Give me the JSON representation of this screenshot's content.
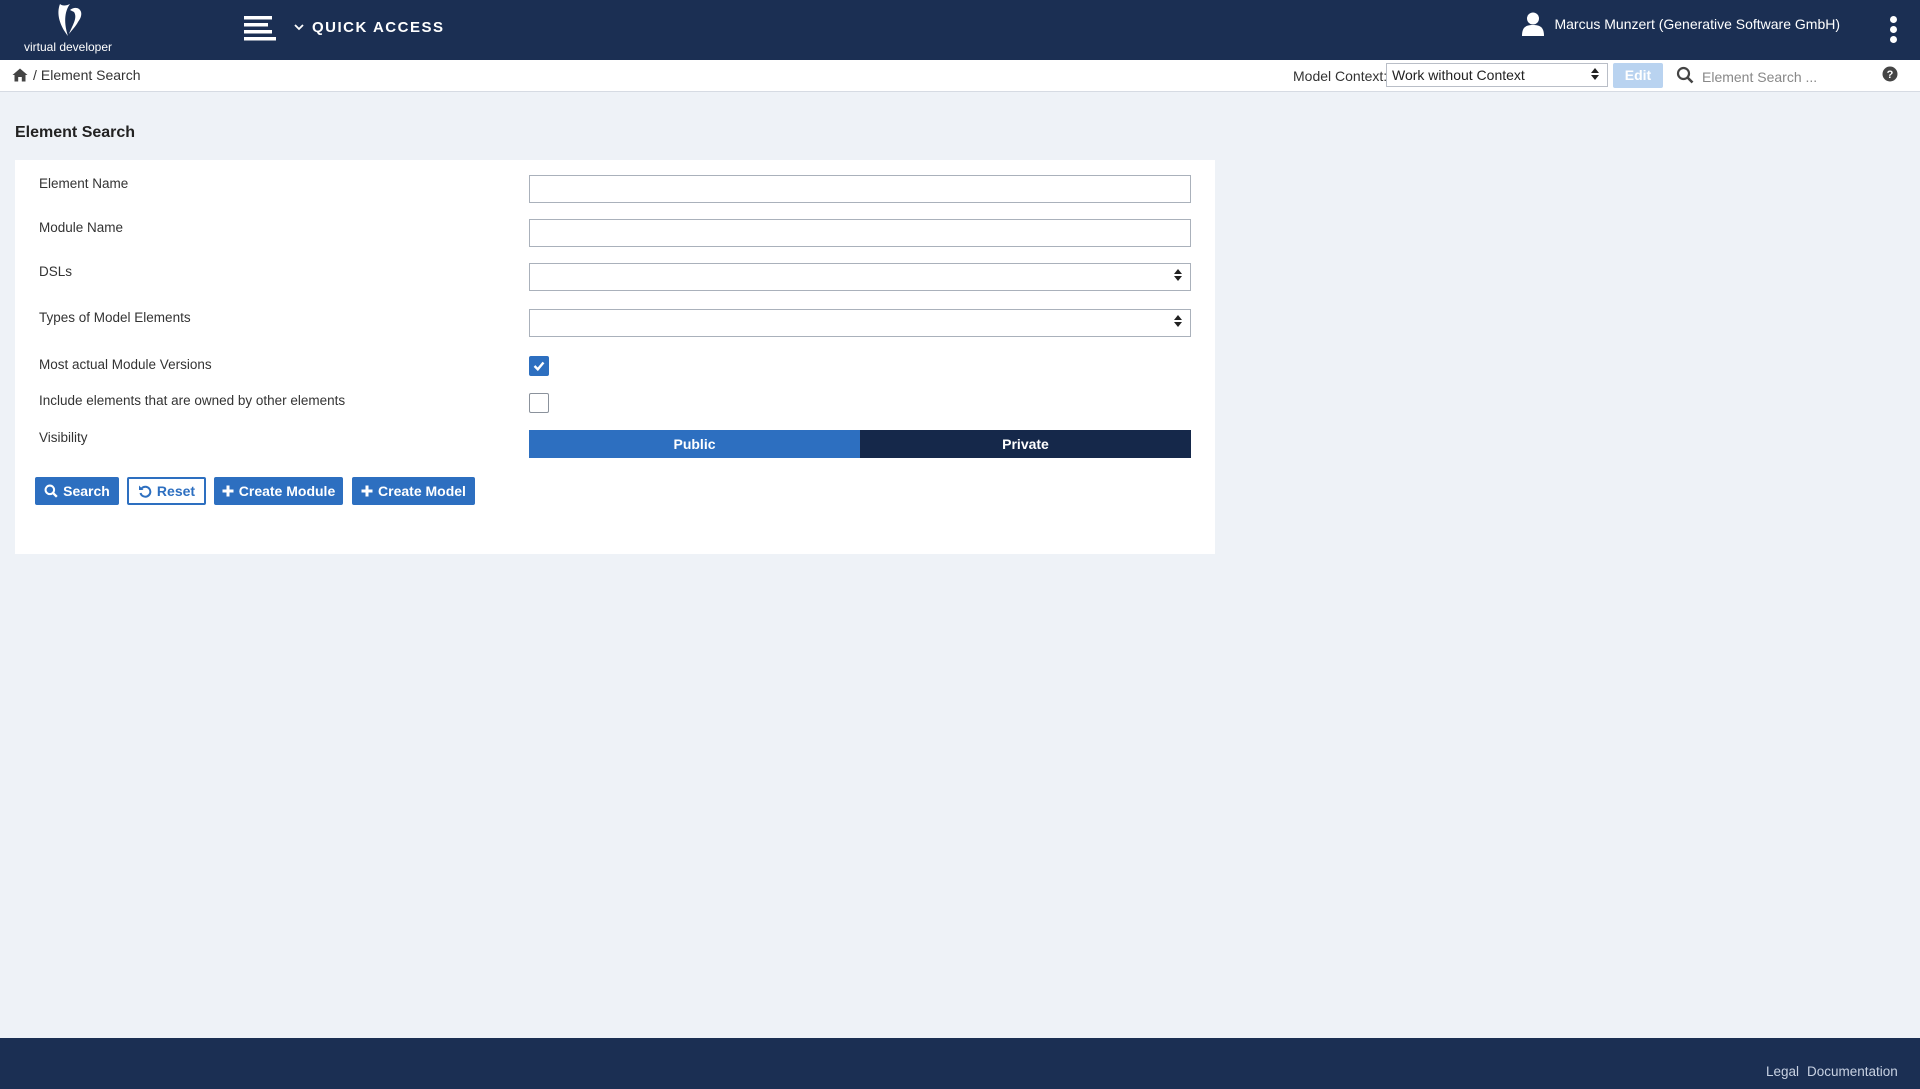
{
  "header": {
    "logo_text": "virtual developer",
    "quick_access_label": "QUICK ACCESS",
    "user_name": "Marcus Munzert (Generative Software GmbH)"
  },
  "context_bar": {
    "breadcrumb_current": "Element Search",
    "model_context_label": "Model Context:",
    "model_context_value": "Work without Context",
    "edit_label": "Edit",
    "search_placeholder": "Element Search ..."
  },
  "page": {
    "title": "Element Search",
    "form": {
      "element_name_label": "Element Name",
      "element_name_value": "",
      "module_name_label": "Module Name",
      "module_name_value": "",
      "dsls_label": "DSLs",
      "dsls_value": "",
      "types_label": "Types of Model Elements",
      "types_value": "",
      "most_actual_label": "Most actual Module Versions",
      "most_actual_checked": true,
      "include_owned_label": "Include elements that are owned by other elements",
      "include_owned_checked": false,
      "visibility_label": "Visibility",
      "visibility_options": [
        "Public",
        "Private"
      ],
      "visibility_selected": "Public"
    },
    "buttons": {
      "search": "Search",
      "reset": "Reset",
      "create_module": "Create Module",
      "create_model": "Create Model"
    }
  },
  "footer": {
    "legal": "Legal",
    "documentation": "Documentation"
  },
  "colors": {
    "header_bg": "#1b2f53",
    "primary": "#2d6fc0",
    "secondary_dark": "#15284a",
    "page_bg": "#eef2f7"
  },
  "icons": [
    "logo-icon",
    "menu-icon",
    "chevron-down-icon",
    "user-icon",
    "kebab-menu-icon",
    "home-icon",
    "search-icon",
    "help-icon",
    "undo-icon",
    "plus-icon",
    "checkmark-icon",
    "sort-arrows-icon"
  ]
}
